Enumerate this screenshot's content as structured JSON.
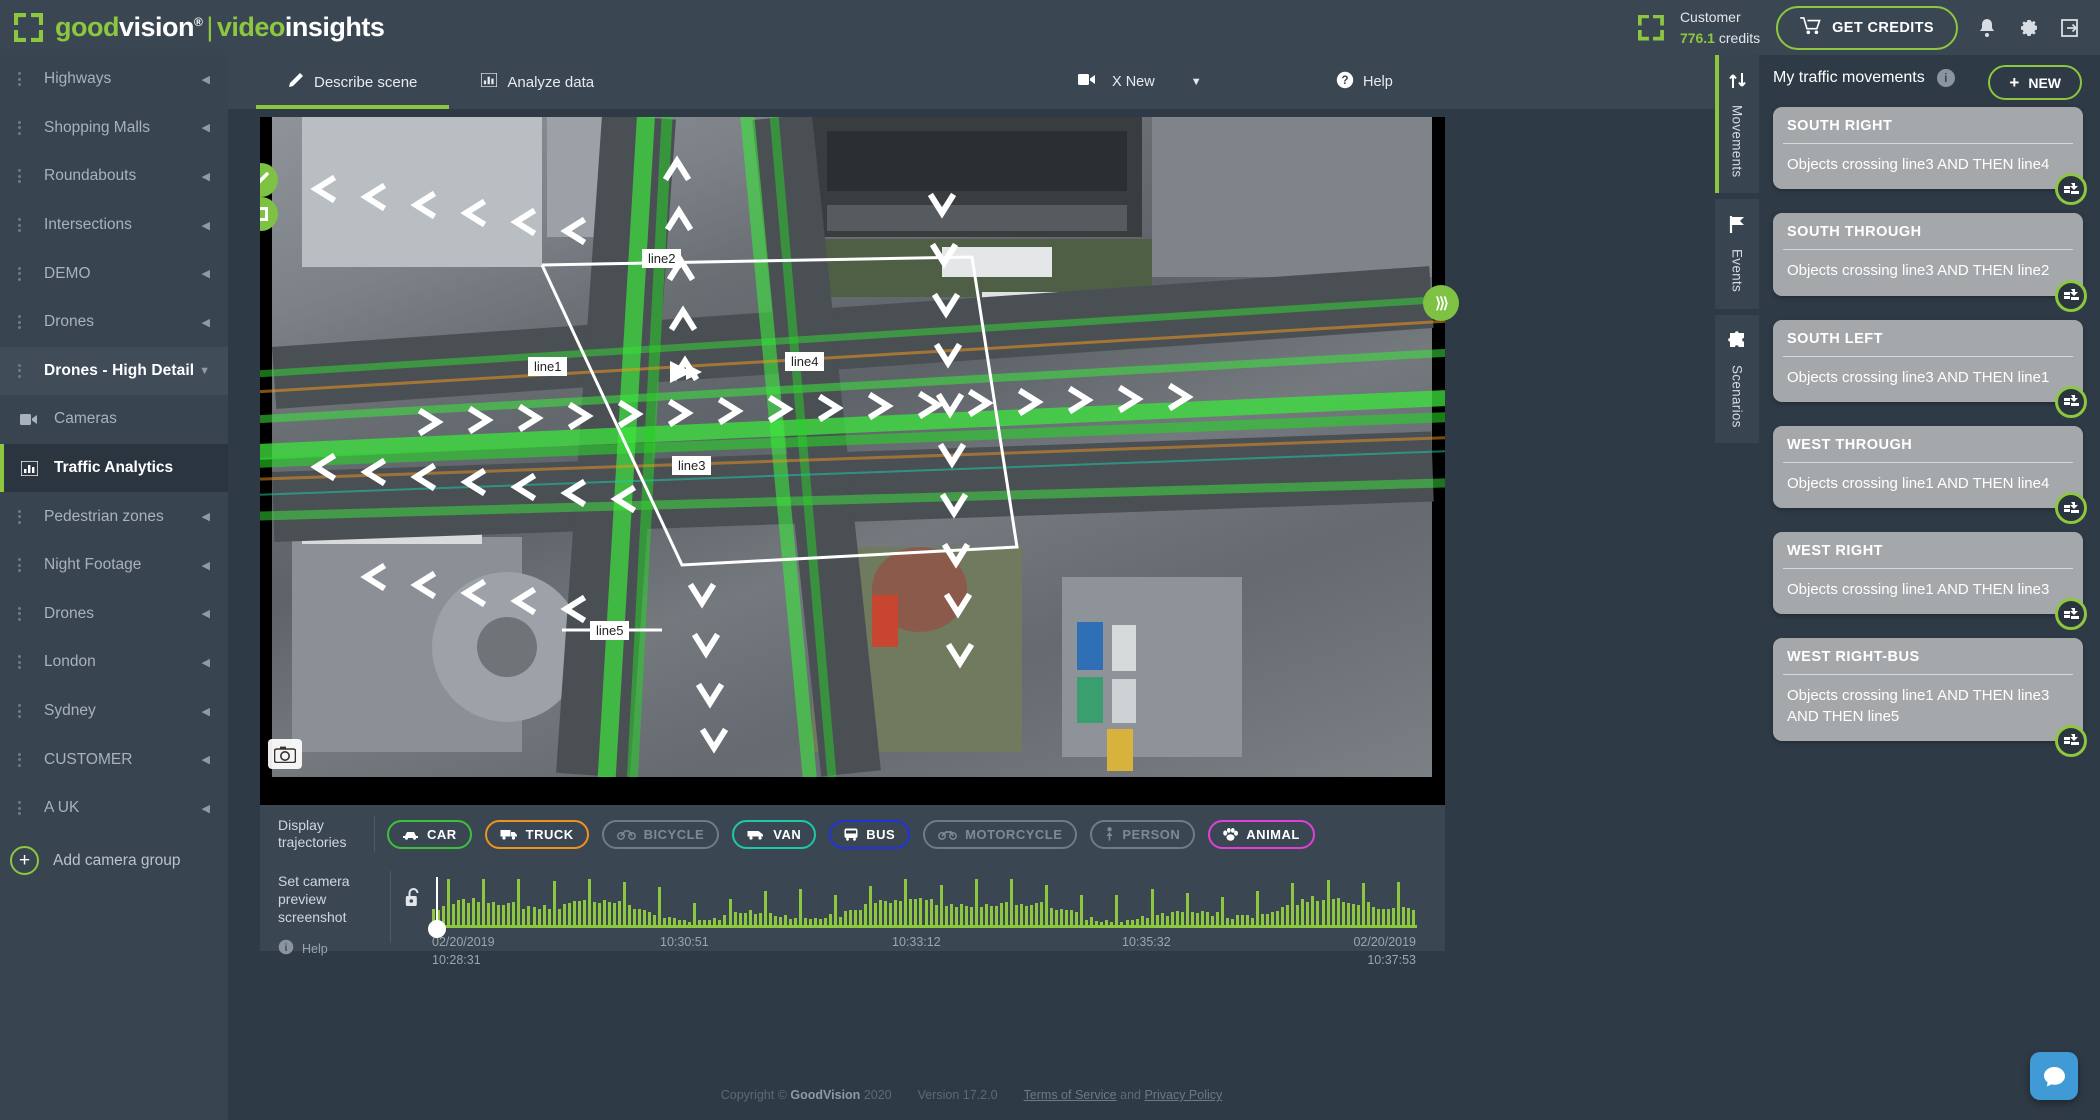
{
  "header": {
    "logo_good": "good",
    "logo_vision": "vision",
    "logo_reg": "®",
    "logo_sep": "|",
    "logo_video": "video",
    "logo_insights": "insights",
    "customer_label": "Customer",
    "credits_value": "776.1",
    "credits_unit": "credits",
    "get_credits_label": "GET CREDITS",
    "icons": [
      "cart-icon",
      "bell-icon",
      "gear-icon",
      "logout-icon"
    ],
    "accent_green": "#8dc63f"
  },
  "sidebar": {
    "groups": [
      {
        "label": "Highways",
        "expanded": false
      },
      {
        "label": "Shopping Malls",
        "expanded": false
      },
      {
        "label": "Roundabouts",
        "expanded": false
      },
      {
        "label": "Intersections",
        "expanded": false
      },
      {
        "label": "DEMO",
        "expanded": false
      },
      {
        "label": "Drones",
        "expanded": false
      },
      {
        "label": "Drones - High Detail",
        "expanded": true
      }
    ],
    "subitems": [
      {
        "label": "Cameras",
        "icon": "camera-icon",
        "active": false
      },
      {
        "label": "Traffic Analytics",
        "icon": "bar-chart-icon",
        "active": true
      }
    ],
    "groups_after": [
      {
        "label": "Pedestrian zones",
        "expanded": false
      },
      {
        "label": "Night Footage",
        "expanded": false
      },
      {
        "label": "Drones",
        "expanded": false
      },
      {
        "label": "London",
        "expanded": false
      },
      {
        "label": "Sydney",
        "expanded": false
      },
      {
        "label": "CUSTOMER",
        "expanded": false
      },
      {
        "label": "A UK",
        "expanded": false
      }
    ],
    "add_group_label": "Add camera group"
  },
  "tabs": {
    "describe": "Describe scene",
    "analyze": "Analyze data",
    "camera_name": "X New",
    "help": "Help"
  },
  "video": {
    "line_labels": [
      "line1",
      "line2",
      "line3",
      "line4",
      "line5"
    ],
    "tools": [
      "draw-line-tool",
      "draw-zone-tool",
      "screenshot-tool",
      "next-step-button"
    ]
  },
  "trajectories": {
    "label_line1": "Display",
    "label_line2": "trajectories",
    "classes": [
      {
        "name": "CAR",
        "icon": "car-icon",
        "active": true,
        "color": "#3cc13b"
      },
      {
        "name": "TRUCK",
        "icon": "truck-icon",
        "active": true,
        "color": "#f0921e"
      },
      {
        "name": "BICYCLE",
        "icon": "bicycle-icon",
        "active": false,
        "color": "#7d8993"
      },
      {
        "name": "VAN",
        "icon": "van-icon",
        "active": true,
        "color": "#1ec8a5"
      },
      {
        "name": "BUS",
        "icon": "bus-icon",
        "active": true,
        "color": "#2233dd"
      },
      {
        "name": "MOTORCYCLE",
        "icon": "motorcycle-icon",
        "active": false,
        "color": "#7d8993"
      },
      {
        "name": "PERSON",
        "icon": "person-icon",
        "active": false,
        "color": "#7d8993"
      },
      {
        "name": "ANIMAL",
        "icon": "animal-icon",
        "active": true,
        "color": "#e040d8"
      }
    ]
  },
  "timeline": {
    "label_line1": "Set camera",
    "label_line2": "preview",
    "label_line3": "screenshot",
    "help": "Help",
    "lock_icon": "unlocked-padlock-icon",
    "start_date": "02/20/2019",
    "start_time": "10:28:31",
    "tick1": "10:30:51",
    "tick2": "10:33:12",
    "tick3": "10:35:32",
    "end_date": "02/20/2019",
    "end_time": "10:37:53"
  },
  "right_panel": {
    "vtabs": [
      {
        "label": "Movements",
        "icon": "movements-icon",
        "active": true
      },
      {
        "label": "Events",
        "icon": "flag-icon",
        "active": false
      },
      {
        "label": "Scenarios",
        "icon": "puzzle-icon",
        "active": false
      }
    ],
    "title": "My traffic movements",
    "info_icon": "info-icon",
    "new_label": "NEW",
    "movements": [
      {
        "name": "SOUTH RIGHT",
        "rule": "Objects crossing line3 AND THEN line4"
      },
      {
        "name": "SOUTH THROUGH",
        "rule": "Objects crossing line3 AND THEN line2"
      },
      {
        "name": "SOUTH LEFT",
        "rule": "Objects crossing line3 AND THEN line1"
      },
      {
        "name": "WEST THROUGH",
        "rule": "Objects crossing line1 AND THEN line4"
      },
      {
        "name": "WEST RIGHT",
        "rule": "Objects crossing line1 AND THEN line3"
      },
      {
        "name": "WEST RIGHT-BUS",
        "rule": "Objects crossing line1 AND THEN line3 AND THEN line5"
      }
    ]
  },
  "footer": {
    "copyright_pre": "Copyright ©",
    "brand": "GoodVision",
    "year": "2020",
    "version": "Version 17.2.0",
    "terms": "Terms of Service",
    "and": "and",
    "privacy": "Privacy Policy"
  }
}
